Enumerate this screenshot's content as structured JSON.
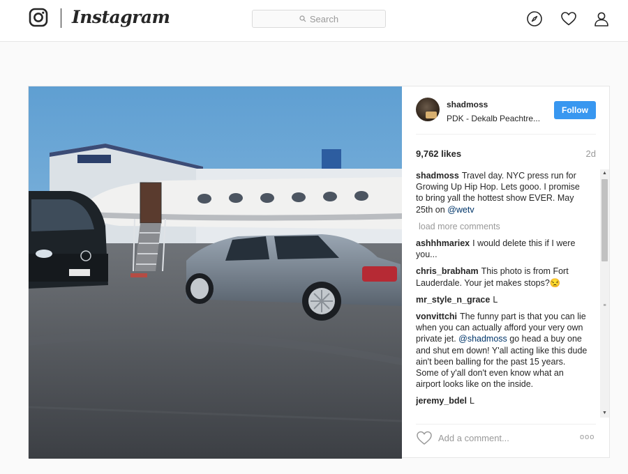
{
  "nav": {
    "brand": "Instagram",
    "search_placeholder": "Search",
    "icons": [
      "instagram-logo-icon",
      "search-icon",
      "compass-icon",
      "heart-icon",
      "user-icon"
    ]
  },
  "post": {
    "username": "shadmoss",
    "location": "PDK - Dekalb Peachtre...",
    "follow_label": "Follow",
    "likes": "9,762 likes",
    "age": "2d",
    "caption": {
      "user": "shadmoss",
      "text_before": "Travel day. NYC press run for Growing Up Hip Hop. Lets gooo. I promise to bring yall the hottest show EVER. May 25th on ",
      "mention": "@wetv"
    },
    "load_more": "load more comments",
    "comments": [
      {
        "user": "ashhhmariex",
        "text": "I would delete this if I were you..."
      },
      {
        "user": "chris_brabham",
        "text": "This photo is from Fort Lauderdale. Your jet makes stops?😒"
      },
      {
        "user": "mr_style_n_grace",
        "text": "L"
      },
      {
        "user": "vonvittchi",
        "text_before": "The funny part is that you can lie when you can actually afford your very own private jet. ",
        "mention": "@shadmoss",
        "text_after": " go head a buy one and shut em down! Y'all acting like this dude ain't been balling for the past 15 years. Some of y'all don't even know what an airport looks like on the inside."
      },
      {
        "user": "jeremy_bdel",
        "text": "L"
      }
    ],
    "add_comment_placeholder": "Add a comment...",
    "more_label": "ooo"
  },
  "colors": {
    "follow_blue": "#3897f0",
    "mention_blue": "#003569",
    "muted_gray": "#999999"
  }
}
